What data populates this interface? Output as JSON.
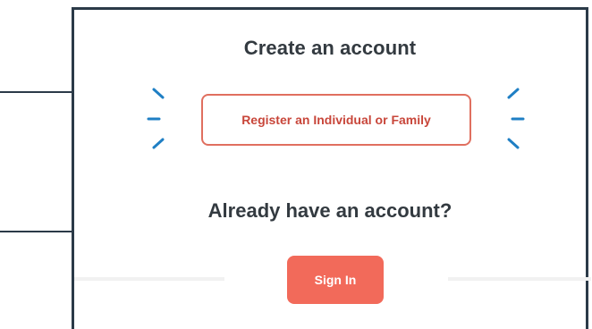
{
  "create_section": {
    "title": "Create an account",
    "register_label": "Register an Individual or Family"
  },
  "signin_section": {
    "title": "Already have an account?",
    "signin_label": "Sign In"
  },
  "colors": {
    "accent": "#f26a5a",
    "accent_border": "#e06f5f",
    "accent_text": "#c8463a",
    "sparkle": "#1f7fc4",
    "frame": "#2b3a48",
    "heading": "#333a40"
  },
  "icons": {
    "left_decoration": "sparkle-burst-icon",
    "right_decoration": "sparkle-burst-icon"
  }
}
